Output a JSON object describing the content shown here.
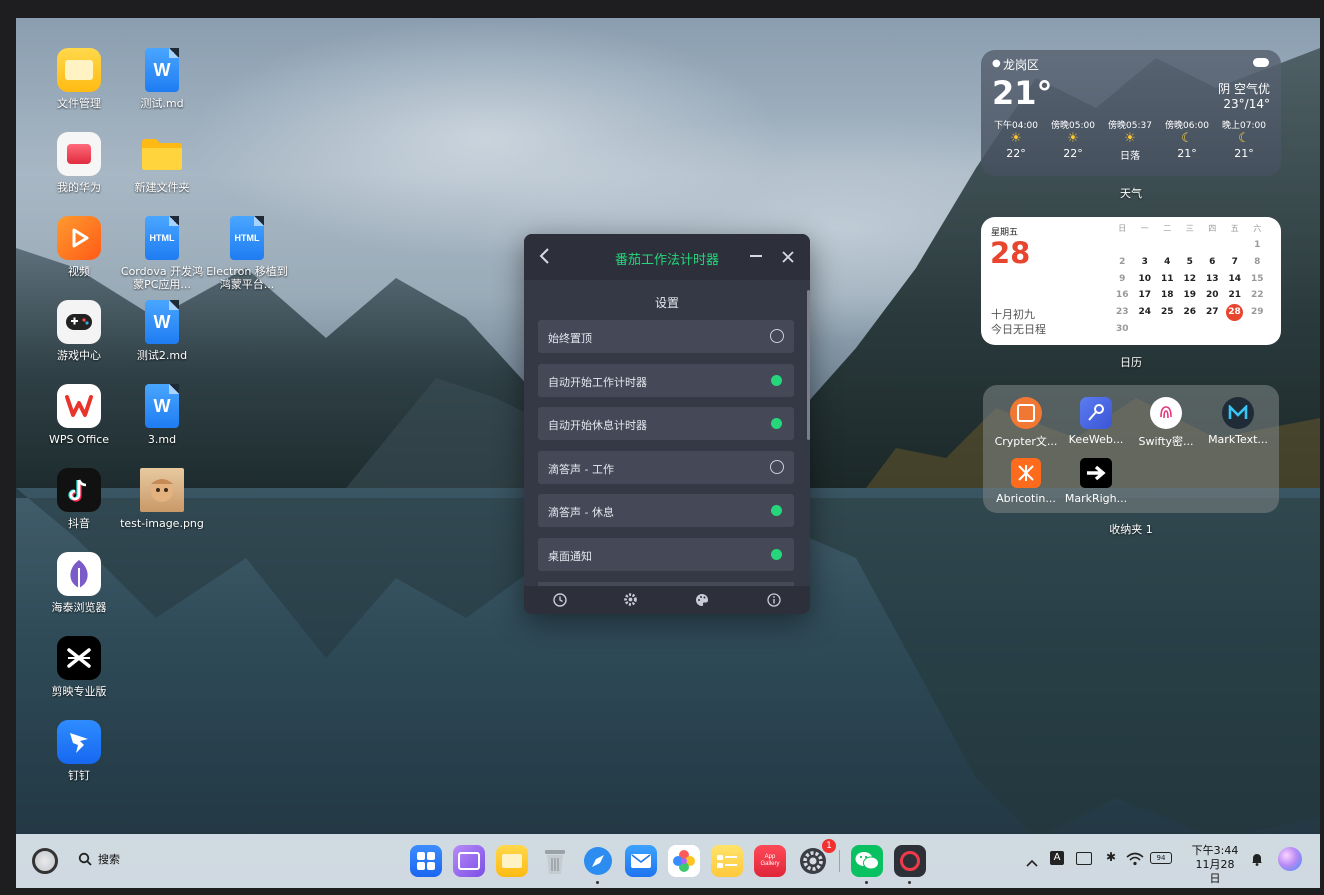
{
  "desktop_icons": [
    {
      "label": "文件管理",
      "icon": "folder-files-icon"
    },
    {
      "label": "测试.md",
      "icon": "word-doc-icon",
      "badge": "W"
    },
    {
      "label": "我的华为",
      "icon": "my-huawei-icon"
    },
    {
      "label": "新建文件夹",
      "icon": "folder-icon"
    },
    {
      "label": "视频",
      "icon": "video-icon"
    },
    {
      "label": "Cordova 开发鸿蒙PC应用...",
      "icon": "html-file-icon",
      "badge": "HTML"
    },
    {
      "label": "Electron 移植到鸿蒙平台...",
      "icon": "html-file-icon",
      "badge": "HTML"
    },
    {
      "label": "游戏中心",
      "icon": "gamepad-icon"
    },
    {
      "label": "测试2.md",
      "icon": "word-doc-icon",
      "badge": "W"
    },
    {
      "label": "WPS Office",
      "icon": "wps-icon"
    },
    {
      "label": "3.md",
      "icon": "word-doc-icon",
      "badge": "W"
    },
    {
      "label": "抖音",
      "icon": "douyin-icon"
    },
    {
      "label": "test-image.png",
      "icon": "image-thumbnail-icon"
    },
    {
      "label": "海泰浏览器",
      "icon": "browser-icon"
    },
    {
      "label": "剪映专业版",
      "icon": "capcut-icon"
    },
    {
      "label": "钉钉",
      "icon": "dingtalk-icon"
    }
  ],
  "weather": {
    "location": "龙岗区",
    "temp": "21°",
    "condition": "阴  空气优",
    "range": "23°/14°",
    "hours": [
      {
        "time": "下午04:00",
        "icon": "sun-icon",
        "temp": "22°"
      },
      {
        "time": "傍晚05:00",
        "icon": "sun-icon",
        "temp": "22°"
      },
      {
        "time": "傍晚05:37",
        "icon": "sunset-icon",
        "temp": "日落"
      },
      {
        "time": "傍晚06:00",
        "icon": "moon-icon",
        "temp": "21°"
      },
      {
        "time": "晚上07:00",
        "icon": "moon-icon",
        "temp": "21°"
      }
    ],
    "widget_label": "天气"
  },
  "calendar": {
    "weekday": "星期五",
    "day": "28",
    "lunar": "十月初九",
    "no_events": "今日无日程",
    "headers": [
      "日",
      "一",
      "二",
      "三",
      "四",
      "五",
      "六"
    ],
    "weeks": [
      [
        "",
        "",
        "",
        "",
        "",
        "",
        "1"
      ],
      [
        "2",
        "3",
        "4",
        "5",
        "6",
        "7",
        "8"
      ],
      [
        "9",
        "10",
        "11",
        "12",
        "13",
        "14",
        "15"
      ],
      [
        "16",
        "17",
        "18",
        "19",
        "20",
        "21",
        "22"
      ],
      [
        "23",
        "24",
        "25",
        "26",
        "27",
        "28",
        "29"
      ],
      [
        "30",
        "",
        "",
        "",
        "",
        "",
        ""
      ]
    ],
    "today": "28",
    "widget_label": "日历"
  },
  "folder": {
    "apps": [
      {
        "label": "Crypter文...",
        "icon": "crypter-icon"
      },
      {
        "label": "KeeWeb...",
        "icon": "keeweb-icon"
      },
      {
        "label": "Swifty密...",
        "icon": "swifty-icon"
      },
      {
        "label": "MarkText...",
        "icon": "marktext-icon"
      },
      {
        "label": "Abricotin...",
        "icon": "abricotine-icon"
      },
      {
        "label": "MarkRigh...",
        "icon": "markright-icon"
      }
    ],
    "widget_label": "收纳夹 1"
  },
  "pomodoro": {
    "title": "番茄工作法计时器",
    "section": "设置",
    "settings": [
      {
        "label": "始终置顶",
        "on": false
      },
      {
        "label": "自动开始工作计时器",
        "on": true
      },
      {
        "label": "自动开始休息计时器",
        "on": true
      },
      {
        "label": "滴答声 - 工作",
        "on": false
      },
      {
        "label": "滴答声 - 休息",
        "on": true
      },
      {
        "label": "桌面通知",
        "on": true
      }
    ],
    "accent": "#25d77a"
  },
  "taskbar": {
    "search_label": "搜索",
    "dock_apps": [
      {
        "name": "app-center",
        "icon": "grid-apps-icon"
      },
      {
        "name": "multi-window",
        "icon": "multi-window-icon"
      },
      {
        "name": "file-manager",
        "icon": "folder-files-icon"
      },
      {
        "name": "recycle-bin",
        "icon": "trash-icon"
      },
      {
        "name": "browser",
        "icon": "compass-browser-icon"
      },
      {
        "name": "mail",
        "icon": "mail-icon"
      },
      {
        "name": "gallery",
        "icon": "gallery-flower-icon"
      },
      {
        "name": "notes",
        "icon": "notes-icon"
      },
      {
        "name": "appgallery",
        "icon": "app-gallery-icon",
        "text": "App\nGallery"
      },
      {
        "name": "settings",
        "icon": "settings-gear-icon",
        "badge": "1"
      },
      {
        "name": "wechat",
        "icon": "wechat-icon"
      },
      {
        "name": "pomodoro",
        "icon": "pomodoro-icon"
      }
    ],
    "ime": "A",
    "battery": "94",
    "time": "下午3:44",
    "date": "11月28日"
  }
}
